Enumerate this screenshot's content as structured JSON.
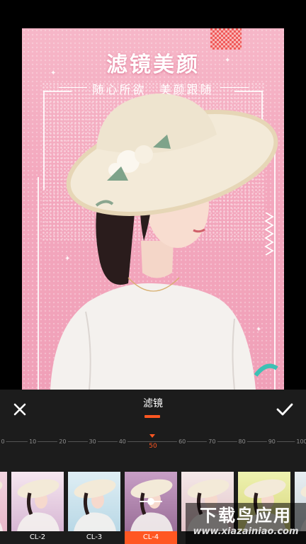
{
  "poster": {
    "title": "滤镜美颜",
    "subtitle": "随心所欲　美颜跟随"
  },
  "panel": {
    "title": "滤镜",
    "close_icon": "close-icon",
    "confirm_icon": "check-icon",
    "accent_color": "#ff5722"
  },
  "intensity": {
    "value": 50,
    "ticks": [
      "0",
      "10",
      "20",
      "30",
      "40",
      "50",
      "60",
      "70",
      "80",
      "90",
      "100"
    ]
  },
  "filters": [
    {
      "label": ""
    },
    {
      "label": "CL-2"
    },
    {
      "label": "CL-3"
    },
    {
      "label": "CL-4",
      "selected": true
    },
    {
      "label": ""
    },
    {
      "label": ""
    },
    {
      "label": ""
    }
  ],
  "watermark": {
    "name": "下载鸟应用",
    "url": "www.xiazainiao.com"
  }
}
